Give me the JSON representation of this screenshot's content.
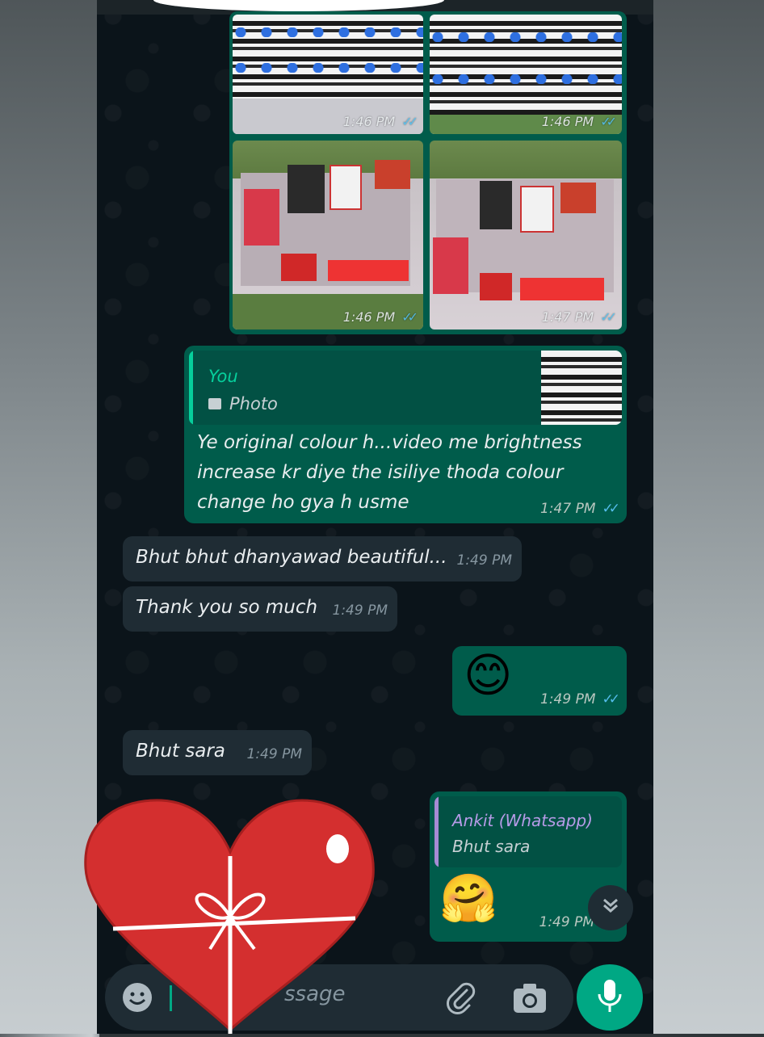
{
  "grid_images": {
    "times": [
      "1:46 PM",
      "1:46 PM",
      "1:46 PM",
      "1:47 PM"
    ]
  },
  "reply_message": {
    "quote_author": "You",
    "quote_type": "Photo",
    "text": "Ye original colour h...video me brightness increase kr diye the isiliye thoda colour change ho gya h usme",
    "time": "1:47 PM"
  },
  "incoming_1": {
    "text": "Bhut bhut dhanyawad beautiful...",
    "time": "1:49 PM"
  },
  "incoming_2": {
    "text": "Thank you so much",
    "time": "1:49 PM"
  },
  "outgoing_emoji": {
    "emoji": "😊",
    "time": "1:49 PM"
  },
  "incoming_3": {
    "text": "Bhut sara",
    "time": "1:49 PM"
  },
  "reply_emoji": {
    "quote_author": "Ankit (Whatsapp)",
    "quote_text": "Bhut sara",
    "emoji": "🤗",
    "time": "1:49 PM"
  },
  "composer": {
    "placeholder_visible": "ssage"
  },
  "colors": {
    "outgoing": "#005c4b",
    "incoming": "#1f2c34",
    "accent": "#00a884",
    "read_ticks": "#53bdeb"
  },
  "icons": {
    "emoji": "emoji-icon",
    "attach": "paperclip-icon",
    "camera": "camera-icon",
    "mic": "mic-icon",
    "scroll": "double-chevron-down-icon",
    "sticker": "heart-gift-sticker"
  }
}
